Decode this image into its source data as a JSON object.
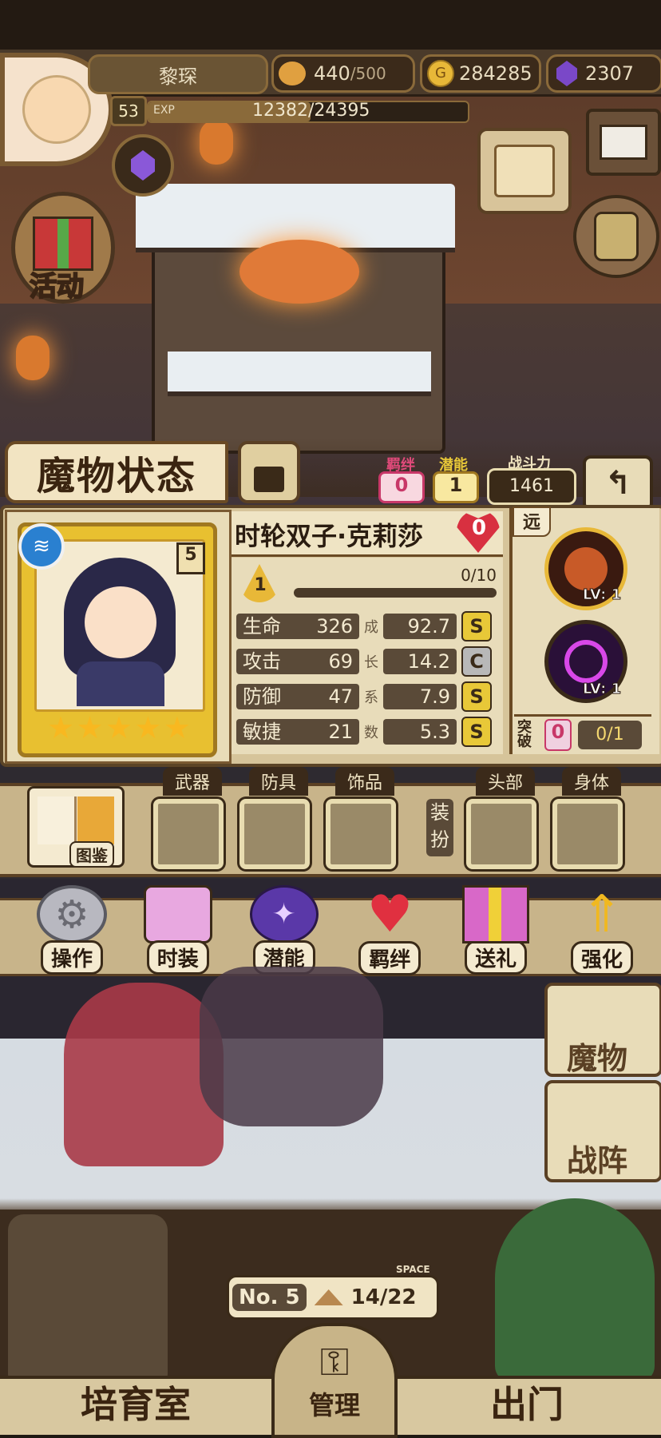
{
  "player": {
    "name": "黎琛",
    "level": "53",
    "exp_label": "EXP",
    "exp_value": "12382/24395"
  },
  "resources": {
    "stamina": "440",
    "stamina_max": "/500",
    "gold": "284285",
    "gems": "2307"
  },
  "left_menu": {
    "activity_label": "活动"
  },
  "monster_status": {
    "title": "魔物状态",
    "bond_label": "羁绊",
    "bond_value": "0",
    "potential_label": "潜能",
    "potential_value": "1",
    "power_label": "战斗力",
    "power_value": "1461"
  },
  "monster": {
    "name": "时轮双子·克莉莎",
    "heart_value": "0",
    "level": "1",
    "progress": "0/10",
    "progress_fraction": 0.0,
    "card_tag": "5",
    "stars": 5,
    "stats": [
      {
        "label": "生命",
        "value": "326",
        "growth": "92.7",
        "grade": "S",
        "grade_color": "#e8c838"
      },
      {
        "label": "攻击",
        "value": "69",
        "growth": "14.2",
        "grade": "C",
        "grade_color": "#b8b8b8"
      },
      {
        "label": "防御",
        "value": "47",
        "growth": "7.9",
        "grade": "S",
        "grade_color": "#e8c838"
      },
      {
        "label": "敏捷",
        "value": "21",
        "growth": "5.3",
        "grade": "S",
        "grade_color": "#e8c838"
      }
    ],
    "growth_label": [
      "成",
      "长",
      "系",
      "数"
    ]
  },
  "skills": {
    "range_tag": "远",
    "skill1_level": "LV: 1",
    "skill2_level": "LV: 1",
    "breakthrough_label": "突破",
    "breakthrough_value": "0",
    "breakthrough_progress": "0/1"
  },
  "equipment": {
    "book_label": "图鉴",
    "weapon": "武器",
    "armor": "防具",
    "accessory": "饰品",
    "dress_label": "装扮",
    "head": "头部",
    "body": "身体"
  },
  "menu": [
    {
      "label": "操作",
      "icon": "gear-icon"
    },
    {
      "label": "时装",
      "icon": "outfit-icon"
    },
    {
      "label": "潜能",
      "icon": "potential-icon"
    },
    {
      "label": "羁绊",
      "icon": "hearts-icon"
    },
    {
      "label": "送礼",
      "icon": "gift-icon"
    },
    {
      "label": "强化",
      "icon": "upgrade-icon"
    }
  ],
  "right_buttons": {
    "monster": "魔物",
    "formation": "战阵"
  },
  "bottom": {
    "room_no": "No. 5",
    "space_label": "SPACE",
    "space_value": "14/22",
    "nurture_room": "培育室",
    "manage": "管理",
    "go_out": "出门"
  }
}
